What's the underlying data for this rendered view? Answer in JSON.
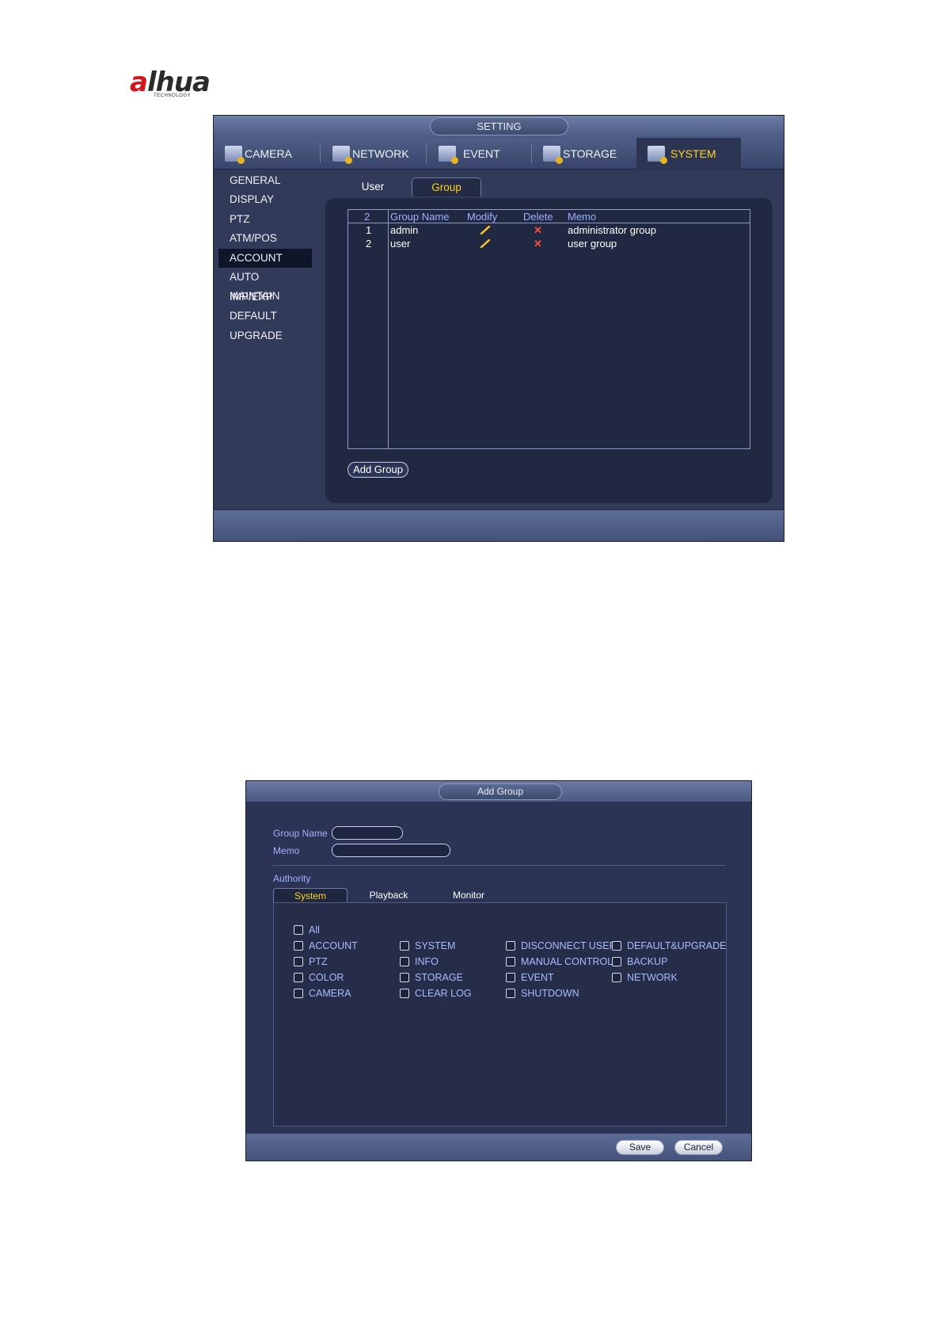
{
  "logo": {
    "brand": "alhua",
    "brand_a": "a",
    "brand_rest": "lhua",
    "subtitle": "TECHNOLOGY"
  },
  "setting_window": {
    "title": "SETTING",
    "tabs": [
      {
        "label": "CAMERA",
        "icon": "camera-gear-icon",
        "active": false
      },
      {
        "label": "NETWORK",
        "icon": "network-gear-icon",
        "active": false
      },
      {
        "label": "EVENT",
        "icon": "event-gear-icon",
        "active": false
      },
      {
        "label": "STORAGE",
        "icon": "storage-gear-icon",
        "active": false
      },
      {
        "label": "SYSTEM",
        "icon": "system-gear-icon",
        "active": true
      }
    ],
    "sidebar": [
      {
        "label": "GENERAL",
        "active": false
      },
      {
        "label": "DISPLAY",
        "active": false
      },
      {
        "label": "PTZ",
        "active": false
      },
      {
        "label": "ATM/POS",
        "active": false
      },
      {
        "label": "ACCOUNT",
        "active": true
      },
      {
        "label": "AUTO MAINTAIN",
        "active": false
      },
      {
        "label": "IMP/EXP",
        "active": false
      },
      {
        "label": "DEFAULT",
        "active": false
      },
      {
        "label": "UPGRADE",
        "active": false
      }
    ],
    "subtabs": [
      {
        "label": "User",
        "active": false
      },
      {
        "label": "Group",
        "active": true
      }
    ],
    "table": {
      "count": "2",
      "headers": {
        "name": "Group Name",
        "modify": "Modify",
        "delete": "Delete",
        "memo": "Memo"
      },
      "rows": [
        {
          "num": "1",
          "name": "admin",
          "memo": "administrator group"
        },
        {
          "num": "2",
          "name": "user",
          "memo": "user group"
        }
      ]
    },
    "add_group_label": "Add Group",
    "colors": {
      "accent": "#ffd21f",
      "header_text": "#9cb0ff",
      "delete": "#ff4a3a"
    }
  },
  "add_group_dialog": {
    "title": "Add Group",
    "group_name_label": "Group Name",
    "group_name_value": "",
    "memo_label": "Memo",
    "memo_value": "",
    "authority_label": "Authority",
    "tabs": [
      {
        "label": "System",
        "active": true
      },
      {
        "label": "Playback",
        "active": false
      },
      {
        "label": "Monitor",
        "active": false
      }
    ],
    "all_label": "All",
    "permissions": [
      [
        "ACCOUNT",
        "PTZ",
        "COLOR",
        "CAMERA"
      ],
      [
        "SYSTEM",
        "INFO",
        "STORAGE",
        "CLEAR LOG"
      ],
      [
        "DISCONNECT USER",
        "MANUAL CONTROL",
        "EVENT",
        "SHUTDOWN"
      ],
      [
        "DEFAULT&UPGRADE",
        "BACKUP",
        "NETWORK"
      ]
    ],
    "save_label": "Save",
    "cancel_label": "Cancel"
  }
}
